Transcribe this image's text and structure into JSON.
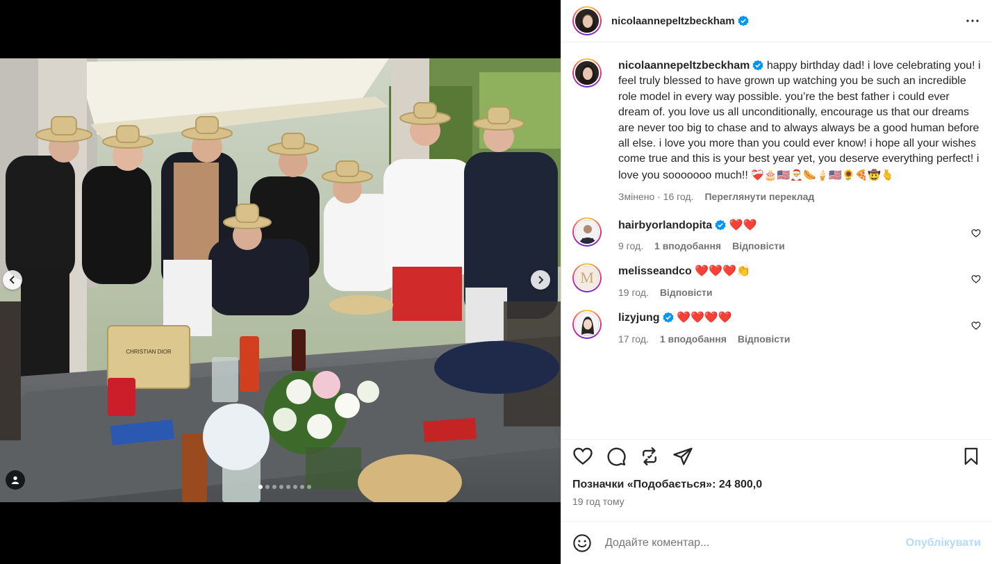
{
  "post": {
    "author": "nicolaannepeltzbeckham",
    "caption": "happy birthday dad! i love celebrating you! i feel truly blessed to have grown up watching you be such an incredible role model in every way possible. you’re the best father i could ever dream of. you love us all unconditionally, encourage us that our dreams are never too big to chase and to always always be a good human before all else. i love you more than you could ever know! i hope all your wishes come true and this is your best year yet, you deserve everything perfect! i love you sooooooo much!!",
    "caption_emojis": "❤️‍🩹🎂🇺🇸🎅🌭🍦🇺🇸🌻🍕🤠🫰",
    "caption_time": "Змінено · 16 год.",
    "translate": "Переглянути переклад",
    "likes": "Позначки «Подобається»: 24 800,0",
    "time_ago": "19 год тому",
    "comment_placeholder": "Додайте коментар...",
    "publish_label": "Опублікувати"
  },
  "comments": [
    {
      "user": "hairbyorlandopita",
      "verified": true,
      "text": "❤️❤️",
      "time": "9 год.",
      "likes": "1 вподобання",
      "reply": "Відповісти"
    },
    {
      "user": "melisseandco",
      "verified": false,
      "text": "❤️❤️❤️👏",
      "time": "19 год.",
      "likes": "",
      "reply": "Відповісти"
    },
    {
      "user": "lizyjung",
      "verified": true,
      "text": "❤️❤️❤️❤️",
      "time": "17 год.",
      "likes": "1 вподобання",
      "reply": "Відповісти"
    }
  ],
  "avatar_letters": {
    "melisseandco": "M"
  },
  "colors": {
    "verified": "#0095f6",
    "muted": "#737373",
    "publish": "#b3dbff",
    "heart": "#ff3040"
  },
  "carousel": {
    "slide_count": 8,
    "active_slide": 1
  },
  "photo_texts": {
    "bag_text": "CHRISTIAN DIOR"
  }
}
